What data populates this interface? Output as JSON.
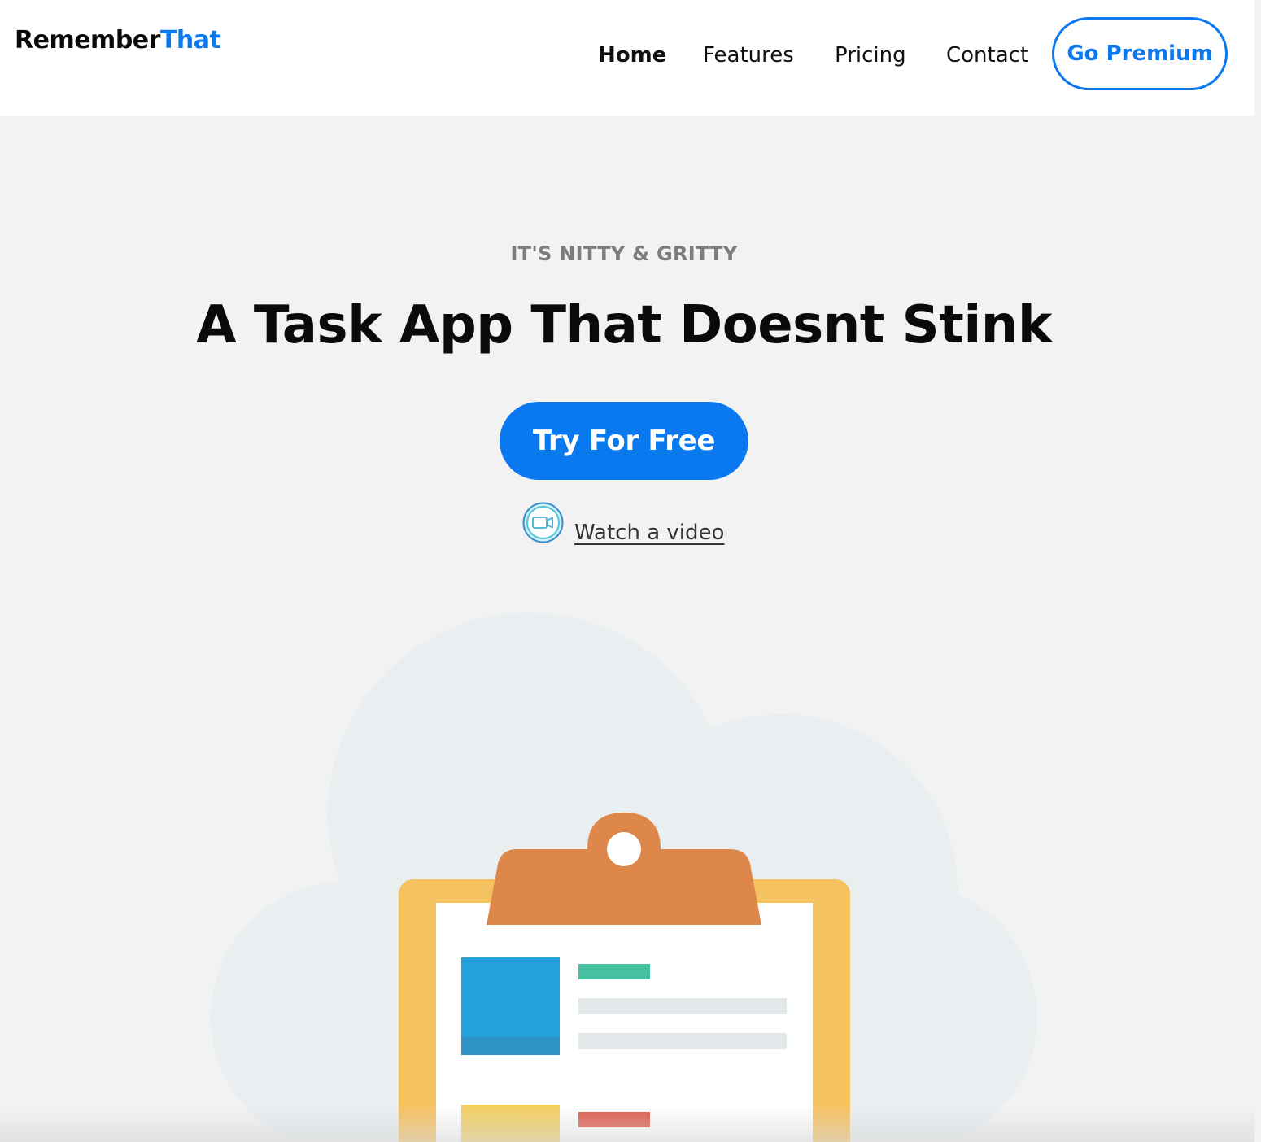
{
  "brand": {
    "name_part1": "Remember",
    "name_part2": "That",
    "accent_color": "#0a78ee"
  },
  "nav": {
    "items": [
      {
        "label": "Home",
        "active": true
      },
      {
        "label": "Features",
        "active": false
      },
      {
        "label": "Pricing",
        "active": false
      },
      {
        "label": "Contact",
        "active": false
      }
    ],
    "premium_label": "Go Premium"
  },
  "hero": {
    "eyebrow": "IT'S NITTY & GRITTY",
    "title": "A Task App That Doesnt Stink",
    "cta_label": "Try For Free",
    "video_link_label": "Watch a video",
    "video_icon": "video-camera-icon"
  },
  "illustration": {
    "icon": "clipboard-illustration",
    "colors": {
      "cloud": "#e9eef1",
      "board": "#f5c262",
      "clip": "#dd874a",
      "paper": "#ffffff",
      "blue_card": "#23a1da",
      "green_bar": "#45c1a0",
      "grey_bar": "#e2e7ea",
      "yellow_card": "#f3cf63",
      "red_bar": "#df5b4d"
    }
  }
}
